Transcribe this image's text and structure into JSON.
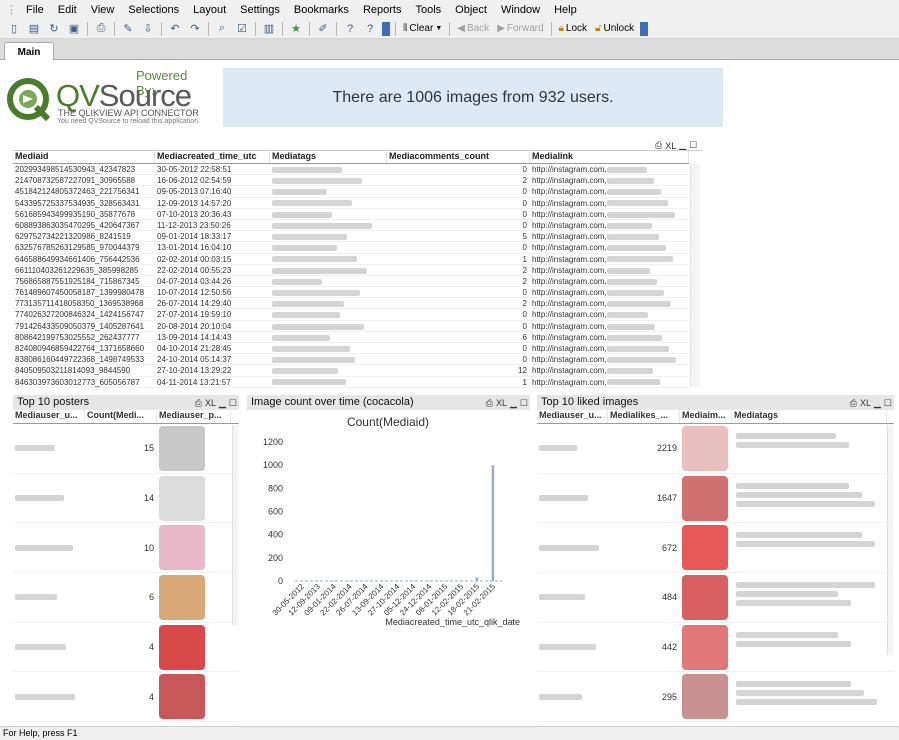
{
  "menu": [
    "File",
    "Edit",
    "View",
    "Selections",
    "Layout",
    "Settings",
    "Bookmarks",
    "Reports",
    "Tools",
    "Object",
    "Window",
    "Help"
  ],
  "toolbar": {
    "clear": "Clear",
    "back": "Back",
    "forward": "Forward",
    "lock": "Lock",
    "unlock": "Unlock"
  },
  "tabs": [
    "Main"
  ],
  "logo": {
    "powered": "Powered By:",
    "brand_a": "QV",
    "brand_b": "Source",
    "tagline": "THE QLIKVIEW API CONNECTOR",
    "reload": "You need QVSource to reload this application."
  },
  "banner": "There are 1006 images from 932 users.",
  "media_table": {
    "xl": "XL",
    "columns": [
      "Mediaid",
      "Mediacreated_time_utc",
      "Mediatags",
      "Mediacomments_count",
      "Medialink"
    ],
    "link_prefix": "http://instagram.com,",
    "rows": [
      [
        "202993498514530943_42347823",
        "30-05-2012 22:58:51",
        "0"
      ],
      [
        "214708732587227091_30965588",
        "16-06-2012 02:54:59",
        "2"
      ],
      [
        "451842124805372463_221756341",
        "09-05-2013 07:16:40",
        "0"
      ],
      [
        "543395725337534935_328563431",
        "12-09-2013 14:57:20",
        "0"
      ],
      [
        "561685943499935190_35877678",
        "07-10-2013 20:36:43",
        "0"
      ],
      [
        "608893863035470295_420647367",
        "11-12-2013 23:50:26",
        "0"
      ],
      [
        "629752734221320986_8241519",
        "09-01-2014 18:33:17",
        "5"
      ],
      [
        "632576785263129585_970044379",
        "13-01-2014 16:04:10",
        "0"
      ],
      [
        "646588649934661406_756442536",
        "02-02-2014 00:03:15",
        "1"
      ],
      [
        "661110403261229635_385998285",
        "22-02-2014 00:55:23",
        "2"
      ],
      [
        "756865887551925184_715867345",
        "04-07-2014 03:44:26",
        "2"
      ],
      [
        "761489607450058187_1399980478",
        "10-07-2014 12:50:56",
        "0"
      ],
      [
        "773135711418058350_1369538968",
        "26-07-2014 14:29:40",
        "2"
      ],
      [
        "774026327200846324_1424156747",
        "27-07-2014 19:59:10",
        "0"
      ],
      [
        "791426433509050379_1405287641",
        "20-08-2014 20:10:04",
        "0"
      ],
      [
        "808642199753025552_262437777",
        "13-09-2014 14:14:43",
        "6"
      ],
      [
        "824080946859422764_1371658660",
        "04-10-2014 21:28:45",
        "0"
      ],
      [
        "838086160449722368_1498749533",
        "24-10-2014 05:14:37",
        "0"
      ],
      [
        "840509503211814093_9844590",
        "27-10-2014 13:29:22",
        "12"
      ],
      [
        "846303973603012773_605056787",
        "04-11-2014 13:21:57",
        "1"
      ]
    ]
  },
  "top_posters": {
    "title": "Top 10 posters",
    "xl": "XL",
    "columns": [
      "Mediauser_u...",
      "Count(Medi...",
      "Mediauser_p..."
    ],
    "counts": [
      "15",
      "14",
      "10",
      "6",
      "4",
      "4"
    ]
  },
  "image_count": {
    "title": "Image count over time (cocacola)",
    "xl": "XL"
  },
  "chart_data": {
    "type": "bar",
    "title": "Count(Mediaid)",
    "xlabel": "Mediacreated_time_utc_qlik_date",
    "ylabel": "",
    "ylim": [
      0,
      1200
    ],
    "yticks": [
      0,
      200,
      400,
      600,
      800,
      1000,
      1200
    ],
    "categories": [
      "30-05-2012",
      "12-09-2013",
      "09-01-2014",
      "22-02-2014",
      "26-07-2014",
      "13-09-2014",
      "27-10-2014",
      "05-12-2014",
      "24-12-2014",
      "06-01-2015",
      "12-02-2015",
      "18-02-2015",
      "21-02-2015"
    ],
    "values": [
      1,
      1,
      1,
      1,
      1,
      1,
      1,
      1,
      1,
      1,
      1,
      30,
      1000
    ]
  },
  "top_liked": {
    "title": "Top 10 liked images",
    "xl": "XL",
    "columns": [
      "Mediauser_u...",
      "Medialikes_...",
      "Mediaim...",
      "Mediatags"
    ],
    "likes": [
      "2219",
      "1647",
      "672",
      "484",
      "442",
      "295"
    ]
  },
  "status": "For Help, press F1",
  "colors": {
    "banner": "#dde8f5",
    "bar": "#8fb0c8",
    "brand": "#4a7c2a"
  }
}
